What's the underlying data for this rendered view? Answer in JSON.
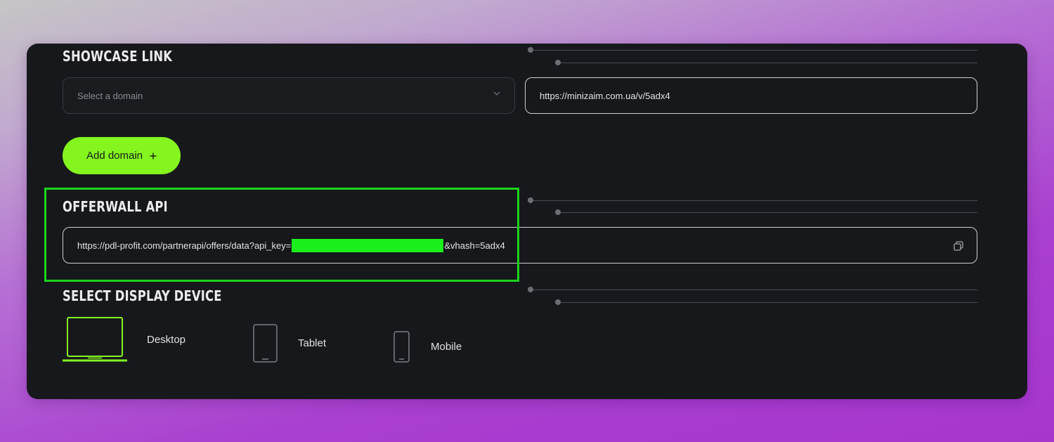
{
  "showcase": {
    "title": "SHOWCASE LINK",
    "domain_placeholder": "Select a domain",
    "link_value": "https://minizaim.com.ua/v/5adx4",
    "add_domain_label": "Add domain",
    "add_icon": "plus-icon"
  },
  "offerwall": {
    "title": "OFFERWALL API",
    "url_prefix": "https://pdl-profit.com/partnerapi/offers/data?api_key=",
    "url_suffix": "&vhash=5adx4",
    "copy_icon": "copy-icon"
  },
  "devices": {
    "title": "SELECT DISPLAY DEVICE",
    "items": [
      {
        "label": "Desktop",
        "icon": "laptop-icon",
        "selected": true
      },
      {
        "label": "Tablet",
        "icon": "tablet-icon",
        "selected": false
      },
      {
        "label": "Mobile",
        "icon": "mobile-icon",
        "selected": false
      }
    ]
  },
  "colors": {
    "accent": "#84f51f",
    "highlight": "#1bd41b",
    "panel_bg": "#17181c"
  }
}
